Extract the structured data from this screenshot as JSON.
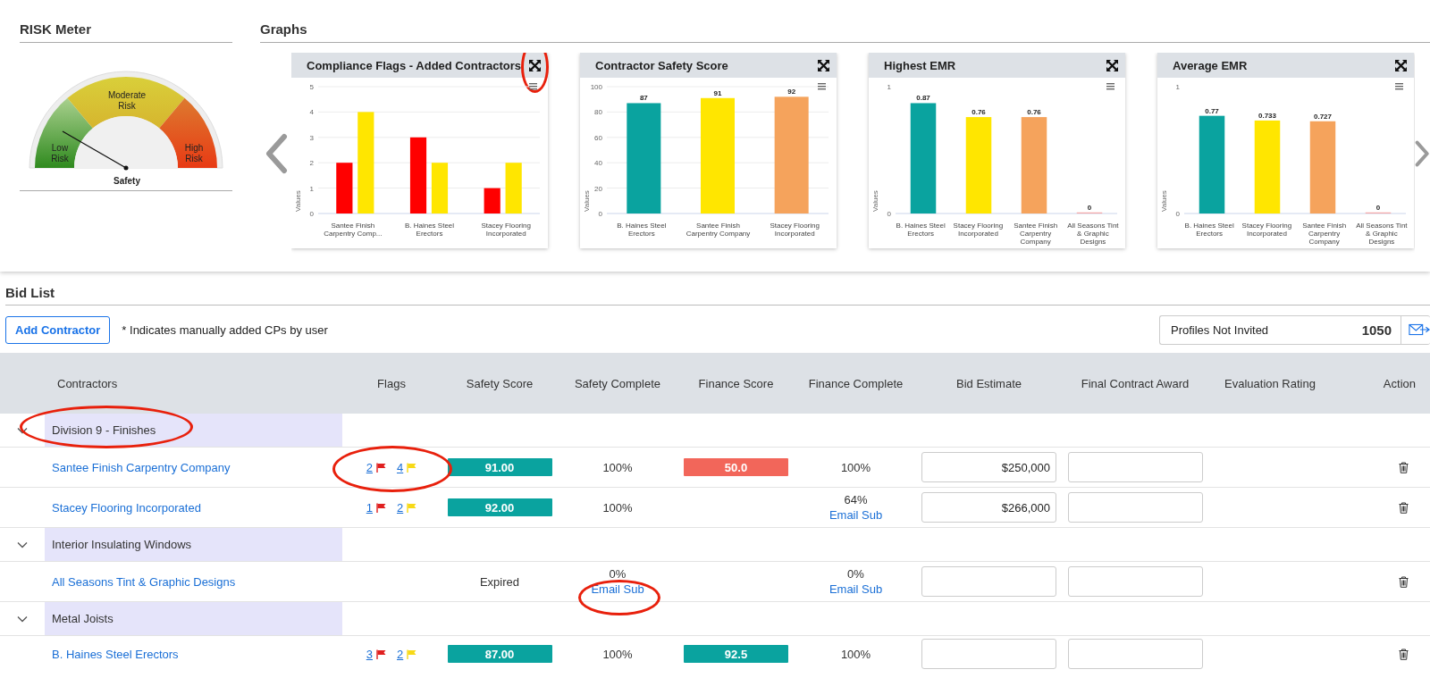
{
  "risk_meter": {
    "title": "RISK Meter",
    "zones": [
      {
        "label": "Low Risk"
      },
      {
        "label": "Moderate Risk"
      },
      {
        "label": "High Risk"
      }
    ],
    "caption": "Safety"
  },
  "graphs": {
    "title": "Graphs",
    "charts": [
      {
        "title": "Compliance Flags - Added Contractors",
        "expand_circled": true,
        "chart_data": {
          "type": "bar",
          "ylabel": "Values",
          "categories": [
            "Santee Finish Carpentry Comp...",
            "B. Haines Steel Erectors",
            "Stacey Flooring Incorporated"
          ],
          "series": [
            {
              "color": "#ff0000",
              "values": [
                2,
                3,
                1
              ]
            },
            {
              "color": "#ffe600",
              "values": [
                4,
                2,
                2
              ]
            }
          ],
          "ylim": [
            0,
            5
          ],
          "yticks": [
            0,
            1,
            2,
            3,
            4,
            5
          ],
          "grid": true
        }
      },
      {
        "title": "Contractor Safety Score",
        "expand_circled": false,
        "chart_data": {
          "type": "bar",
          "ylabel": "Values",
          "categories": [
            "B. Haines Steel Erectors",
            "Santee Finish Carpentry Company",
            "Stacey Flooring Incorporated"
          ],
          "values": [
            87,
            91,
            92
          ],
          "colors": [
            "#0aa39f",
            "#ffe600",
            "#f5a35c"
          ],
          "ylim": [
            0,
            100
          ],
          "yticks": [
            0,
            20,
            40,
            60,
            80,
            100
          ],
          "grid": true,
          "data_labels": true
        }
      },
      {
        "title": "Highest EMR",
        "expand_circled": false,
        "chart_data": {
          "type": "bar",
          "ylabel": "Values",
          "categories": [
            "B. Haines Steel Erectors",
            "Stacey Flooring Incorporated",
            "Santee Finish Carpentry Company",
            "All Seasons Tint & Graphic Designs"
          ],
          "values": [
            0.87,
            0.76,
            0.76,
            0
          ],
          "colors": [
            "#0aa39f",
            "#ffe600",
            "#f5a35c",
            "#f4a6a6"
          ],
          "ylim": [
            0,
            1
          ],
          "yticks": [
            0,
            1
          ],
          "data_labels": true
        }
      },
      {
        "title": "Average EMR",
        "expand_circled": false,
        "chart_data": {
          "type": "bar",
          "ylabel": "Values",
          "categories": [
            "B. Haines Steel Erectors",
            "Stacey Flooring Incorporated",
            "Santee Finish Carpentry Company",
            "All Seasons Tint & Graphic Designs"
          ],
          "values": [
            0.77,
            0.733,
            0.727,
            0
          ],
          "colors": [
            "#0aa39f",
            "#ffe600",
            "#f5a35c",
            "#f4a6a6"
          ],
          "ylim": [
            0,
            1
          ],
          "yticks": [
            0,
            1
          ],
          "data_labels": true
        }
      }
    ]
  },
  "bid_list": {
    "title": "Bid List",
    "add_button": "Add Contractor",
    "note": "* Indicates manually added CPs by user",
    "profiles_not_invited": {
      "label": "Profiles Not Invited",
      "count": "1050"
    }
  },
  "table": {
    "columns": [
      "Contractors",
      "Flags",
      "Safety Score",
      "Safety Complete",
      "Finance Score",
      "Finance Complete",
      "Bid Estimate",
      "Final Contract Award",
      "Evaluation Rating",
      "Action"
    ],
    "groups": [
      {
        "name": "Division 9 - Finishes",
        "expanded": true,
        "circled": true,
        "rows": [
          {
            "contractor": "Santee Finish Carpentry Company",
            "flags": [
              {
                "count": "2",
                "color": "#e02020"
              },
              {
                "count": "4",
                "color": "#f7d917"
              }
            ],
            "flags_circled": true,
            "safety_score": {
              "kind": "badge",
              "text": "91.00",
              "color": "#0aa39f"
            },
            "safety_complete": {
              "text": "100%"
            },
            "finance_score": {
              "kind": "badge",
              "text": "50.0",
              "color": "#f2665a"
            },
            "finance_complete": {
              "text": "100%"
            },
            "bid_estimate": "$250,000"
          },
          {
            "contractor": "Stacey Flooring Incorporated",
            "flags": [
              {
                "count": "1",
                "color": "#e02020"
              },
              {
                "count": "2",
                "color": "#f7d917"
              }
            ],
            "flags_circled": false,
            "safety_score": {
              "kind": "badge",
              "text": "92.00",
              "color": "#0aa39f"
            },
            "safety_complete": {
              "text": "100%"
            },
            "finance_complete": {
              "text": "64%",
              "link": "Email Sub"
            },
            "bid_estimate": "$266,000"
          }
        ]
      },
      {
        "name": "Interior Insulating Windows",
        "expanded": true,
        "circled": false,
        "rows": [
          {
            "contractor": "All Seasons Tint & Graphic Designs",
            "safety_score": {
              "kind": "text",
              "text": "Expired"
            },
            "safety_complete": {
              "text": "0%",
              "link": "Email Sub",
              "circled": true
            },
            "finance_complete": {
              "text": "0%",
              "link": "Email Sub"
            }
          }
        ]
      },
      {
        "name": "Metal Joists",
        "expanded": true,
        "circled": false,
        "rows": [
          {
            "contractor": "B. Haines Steel Erectors",
            "flags": [
              {
                "count": "3",
                "color": "#e02020"
              },
              {
                "count": "2",
                "color": "#f7d917"
              }
            ],
            "flags_circled": false,
            "safety_score": {
              "kind": "badge",
              "text": "87.00",
              "color": "#0aa39f"
            },
            "safety_complete": {
              "text": "100%"
            },
            "finance_score": {
              "kind": "badge",
              "text": "92.5",
              "color": "#0aa39f"
            },
            "finance_complete": {
              "text": "100%"
            }
          }
        ]
      }
    ]
  }
}
